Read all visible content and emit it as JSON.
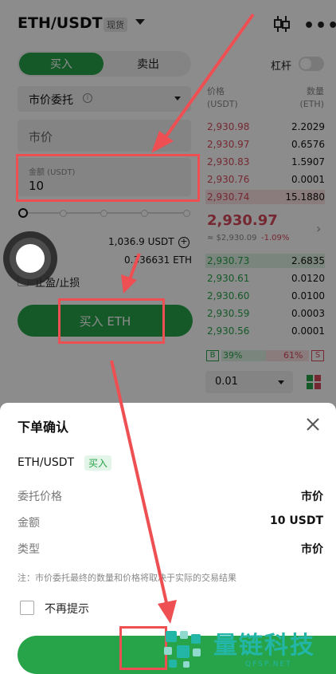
{
  "header": {
    "pair": "ETH/USDT",
    "spot_tag": "现货",
    "more": "•••"
  },
  "tabs": {
    "buy": "买入",
    "sell": "卖出"
  },
  "leverage": {
    "label": "杠杆",
    "enabled": false
  },
  "order_type": {
    "label": "市价委托",
    "info": "i"
  },
  "price_field": {
    "value": "市价"
  },
  "amount_field": {
    "label": "金额 (USDT)",
    "value": "10"
  },
  "slider": {
    "value_fraction": 0
  },
  "available": {
    "usdt": "1,036.9 USDT",
    "eth": "0.336631 ETH",
    "plus": "+"
  },
  "tpsl": {
    "label": "止盈/止损"
  },
  "buy_button": {
    "label": "买入 ETH"
  },
  "orderbook": {
    "head_price": "价格",
    "head_price_unit": "(USDT)",
    "head_qty": "数量",
    "head_qty_unit": "(ETH)",
    "asks": [
      {
        "price": "2,930.98",
        "qty": "2.2029"
      },
      {
        "price": "2,930.97",
        "qty": "0.6576"
      },
      {
        "price": "2,930.83",
        "qty": "1.5907"
      },
      {
        "price": "2,930.76",
        "qty": "0.0001"
      },
      {
        "price": "2,930.74",
        "qty": "15.1880"
      }
    ],
    "last_price": "2,930.97",
    "last_fiat": "≈ $2,930.09",
    "last_change": "-1.09%",
    "arrow": "›",
    "bids": [
      {
        "price": "2,930.73",
        "qty": "2.6835"
      },
      {
        "price": "2,930.61",
        "qty": "0.0120"
      },
      {
        "price": "2,930.60",
        "qty": "0.0100"
      },
      {
        "price": "2,930.59",
        "qty": "0.0003"
      },
      {
        "price": "2,930.56",
        "qty": "0.0001"
      }
    ],
    "buy_ratio_label": "B",
    "buy_ratio": "39%",
    "sell_ratio_label": "S",
    "sell_ratio": "61%",
    "depth": "0.01"
  },
  "sheet": {
    "title": "下单确认",
    "pair": "ETH/USDT",
    "side": "买入",
    "rows": [
      {
        "label": "委托价格",
        "value": "市价"
      },
      {
        "label": "金额",
        "value": "10 USDT"
      },
      {
        "label": "类型",
        "value": "市价"
      }
    ],
    "note": "注：市价委托最终的数量和价格将取决于实际的交易结果",
    "dont_show": "不再提示"
  },
  "watermark": {
    "name": "量链科技",
    "site": "QFSP.NET"
  },
  "colors": {
    "green": "#27a349",
    "red": "#d64a5a",
    "annotation": "#ee4f52",
    "watermark": "#23b5a6"
  }
}
